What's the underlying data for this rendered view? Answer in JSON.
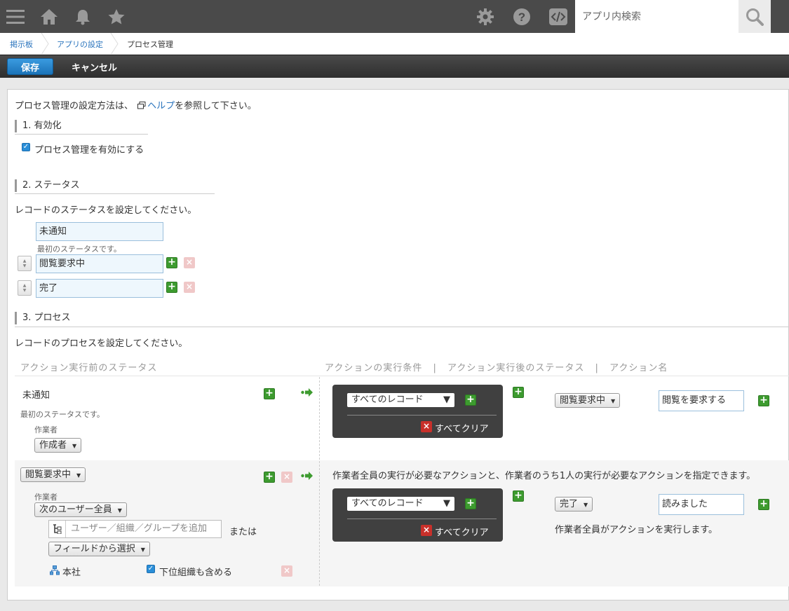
{
  "header": {
    "search_placeholder": "アプリ内検索",
    "icons": [
      "menu-icon",
      "home-icon",
      "bell-icon",
      "star-icon",
      "gear-icon",
      "help-icon",
      "code-icon",
      "search-icon"
    ]
  },
  "breadcrumb": [
    "掲示板",
    "アプリの設定",
    "プロセス管理"
  ],
  "toolbar": {
    "save_label": "保存",
    "cancel_label": "キャンセル"
  },
  "intro": {
    "prefix": "プロセス管理の設定方法は、",
    "link": "ヘルプ",
    "suffix": "を参照して下さい。"
  },
  "section1": {
    "title": "1. 有効化",
    "checkbox_label": "プロセス管理を有効にする"
  },
  "section2": {
    "title": "2. ステータス",
    "description": "レコードのステータスを設定してください。",
    "first_note": "最初のステータスです。",
    "statuses": [
      "未通知",
      "閲覧要求中",
      "完了"
    ]
  },
  "section3": {
    "title": "3. プロセス",
    "description": "レコードのプロセスを設定してください。",
    "col_before": "アクション実行前のステータス",
    "col_cond": "アクションの実行条件",
    "col_after": "アクション実行後のステータス",
    "col_name": "アクション名",
    "sep": "|",
    "row1": {
      "status": "未通知",
      "note": "最初のステータスです。",
      "assignee_label": "作業者",
      "assignee": "作成者",
      "condition": "すべてのレコード",
      "clear_all": "すべてクリア",
      "next_status": "閲覧要求中",
      "action_name": "閲覧を要求する"
    },
    "row2": {
      "status": "閲覧要求中",
      "assignee_label": "作業者",
      "assignee": "次のユーザー全員",
      "member_placeholder": "ユーザー／組織／グループを追加",
      "or": "または",
      "field_select": "フィールドから選択",
      "org": "本社",
      "include_sub": "下位組織も含める",
      "info": "作業者全員の実行が必要なアクションと、作業者のうち1人の実行が必要なアクションを指定できます。",
      "condition": "すべてのレコード",
      "clear_all": "すべてクリア",
      "next_status": "完了",
      "action_name": "読みました",
      "action_note": "作業者全員がアクションを実行します。"
    }
  }
}
